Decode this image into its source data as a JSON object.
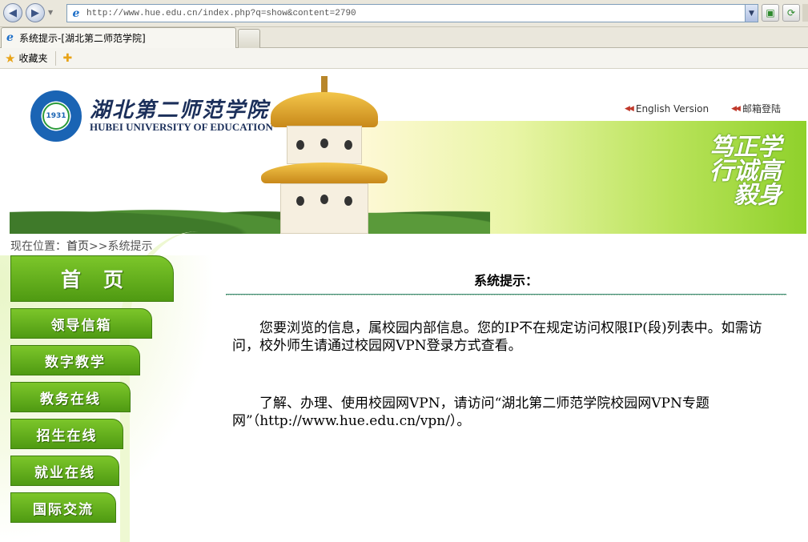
{
  "browser": {
    "address_url": "http://www.hue.edu.cn/index.php?q=show&content=2790",
    "tab_title": "系统提示-[湖北第二师范学院]",
    "favorites_label": "收藏夹"
  },
  "header": {
    "logo_cn": "湖北第二师范学院",
    "logo_en": "HUBEI UNIVERSITY OF EDUCATION",
    "logo_year": "1931",
    "motto": "学高身正诚毅笃行",
    "links": [
      {
        "label": "English Version"
      },
      {
        "label": "邮箱登陆"
      }
    ]
  },
  "breadcrumb": {
    "prefix": "现在位置：",
    "home": "首页",
    "sep": ">>",
    "current": "系统提示"
  },
  "sidebar": {
    "items": [
      {
        "label": "首页"
      },
      {
        "label": "领导信箱"
      },
      {
        "label": "数字教学"
      },
      {
        "label": "教务在线"
      },
      {
        "label": "招生在线"
      },
      {
        "label": "就业在线"
      },
      {
        "label": "国际交流"
      }
    ]
  },
  "content": {
    "title": "系统提示：",
    "paragraph1": "您要浏览的信息，属校园内部信息。您的IP不在规定访问权限IP(段)列表中。如需访问，校外师生请通过校园网VPN登录方式查看。",
    "paragraph2": "了解、办理、使用校园网VPN，请访问“湖北第二师范学院校园网VPN专题网”（http://www.hue.edu.cn/vpn/）。"
  },
  "colors": {
    "menu_green": "#5aa818",
    "accent_blue": "#1a64b4"
  }
}
